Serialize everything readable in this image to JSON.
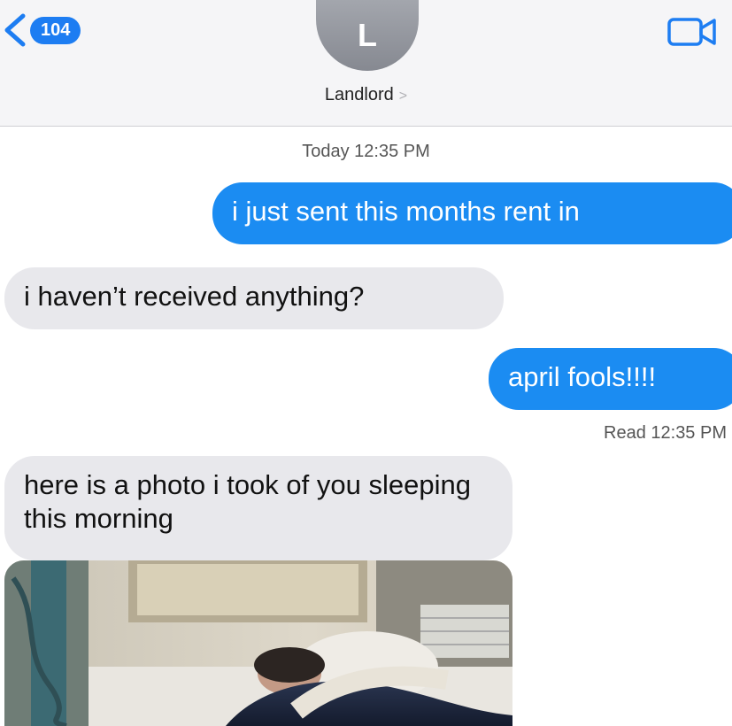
{
  "header": {
    "back_count": "104",
    "avatar_initial": "L",
    "contact_name": "Landlord",
    "contact_chevron": ">",
    "video_icon": "video-camera-icon"
  },
  "conversation": {
    "timestamp": "Today 12:35 PM",
    "messages": [
      {
        "from": "me",
        "text": "i just sent this months rent in"
      },
      {
        "from": "them",
        "text": "i haven’t received anything?"
      },
      {
        "from": "me",
        "text": "april fools!!!!"
      },
      {
        "from": "them",
        "text": "here is a photo i took of you sleeping this morning"
      }
    ],
    "read_receipt": "Read 12:35 PM"
  },
  "colors": {
    "sent_bubble": "#1b8cf2",
    "received_bubble": "#e8e8ec",
    "badge": "#1d7df2"
  }
}
